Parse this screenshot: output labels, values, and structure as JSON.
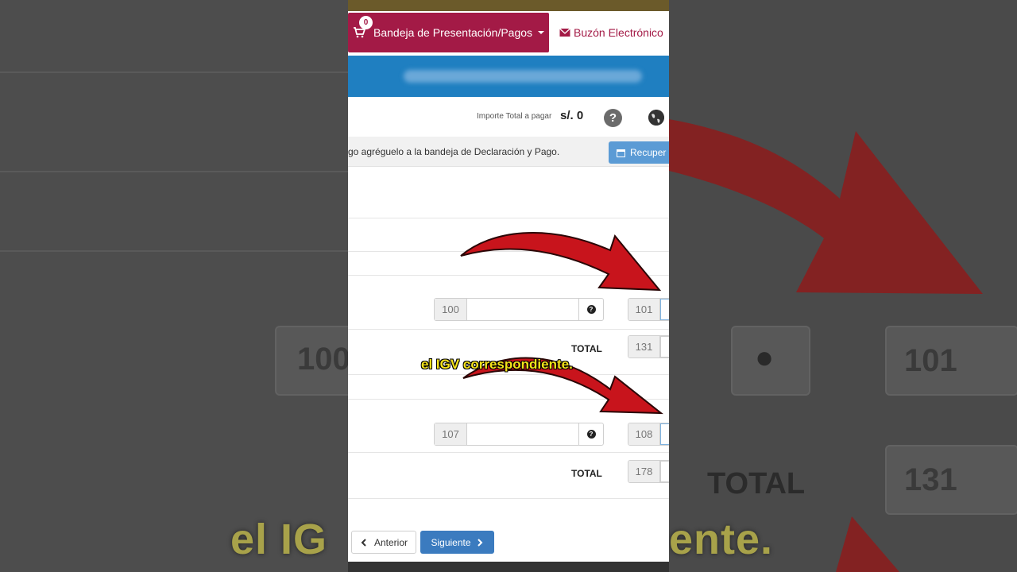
{
  "nav": {
    "cart_count": "0",
    "bandeja_label": "Bandeja de Presentación/Pagos",
    "buzon_label": "Buzón Electrónico"
  },
  "importe": {
    "label": "Importe Total a pagar",
    "value": "s/. 0"
  },
  "message": {
    "text": "go agréguelo a la bandeja de Declaración y Pago.",
    "recuperar_label": "Recuper"
  },
  "rows": [
    {
      "code_left": "100",
      "code_right": "101"
    },
    {
      "total_label": "TOTAL",
      "code": "131"
    },
    {
      "code_left": "107",
      "code_right": "108"
    },
    {
      "total_label": "TOTAL",
      "code": "178"
    }
  ],
  "buttons": {
    "anterior": "Anterior",
    "siguiente": "Siguiente"
  },
  "caption": "el IGV correspondiente.",
  "background": {
    "code_100": "100",
    "code_101": "101",
    "total_label": "TOTAL",
    "code_131": "131",
    "caption_left": "el IG",
    "caption_right": "ente."
  },
  "colors": {
    "brand": "#a31a46",
    "blue_bar": "#1f7fc1",
    "primary_button": "#3b7bbf",
    "arrow": "#c8141c",
    "caption": "#f5e21a"
  }
}
